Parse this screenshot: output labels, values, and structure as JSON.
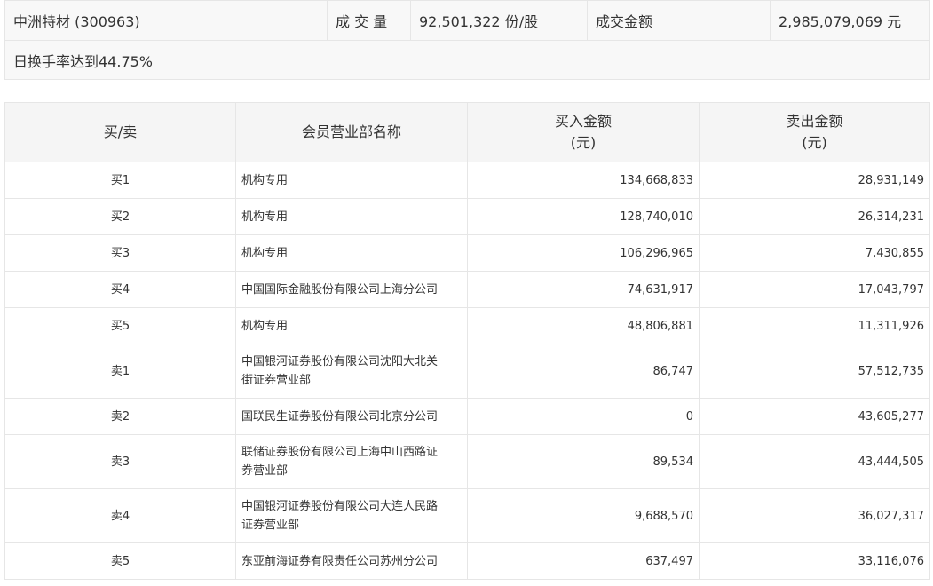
{
  "summary": {
    "stock_label": "中洲特材 (300963)",
    "volume_label": "成 交 量",
    "volume_value": "92,501,322 份/股",
    "amount_label": "成交金额",
    "amount_value": "2,985,079,069 元",
    "reason": "日换手率达到44.75%"
  },
  "table": {
    "headers": {
      "side": "买/卖",
      "member": "会员营业部名称",
      "buy_line1": "买入金额",
      "buy_line2": "(元)",
      "sell_line1": "卖出金额",
      "sell_line2": "(元)"
    },
    "rows": [
      {
        "side": "买1",
        "member": "机构专用",
        "buy": "134,668,833",
        "sell": "28,931,149"
      },
      {
        "side": "买2",
        "member": "机构专用",
        "buy": "128,740,010",
        "sell": "26,314,231"
      },
      {
        "side": "买3",
        "member": "机构专用",
        "buy": "106,296,965",
        "sell": "7,430,855"
      },
      {
        "side": "买4",
        "member": "中国国际金融股份有限公司上海分公司",
        "buy": "74,631,917",
        "sell": "17,043,797"
      },
      {
        "side": "买5",
        "member": "机构专用",
        "buy": "48,806,881",
        "sell": "11,311,926"
      },
      {
        "side": "卖1",
        "member_line1": "中国银河证券股份有限公司沈阳大北关",
        "member_line2": "街证券营业部",
        "buy": "86,747",
        "sell": "57,512,735"
      },
      {
        "side": "卖2",
        "member": "国联民生证券股份有限公司北京分公司",
        "buy": "0",
        "sell": "43,605,277"
      },
      {
        "side": "卖3",
        "member_line1": "联储证券股份有限公司上海中山西路证",
        "member_line2": "券营业部",
        "buy": "89,534",
        "sell": "43,444,505"
      },
      {
        "side": "卖4",
        "member_line1": "中国银河证券股份有限公司大连人民路",
        "member_line2": "证券营业部",
        "buy": "9,688,570",
        "sell": "36,027,317"
      },
      {
        "side": "卖5",
        "member": "东亚前海证券有限责任公司苏州分公司",
        "buy": "637,497",
        "sell": "33,116,076"
      }
    ]
  }
}
